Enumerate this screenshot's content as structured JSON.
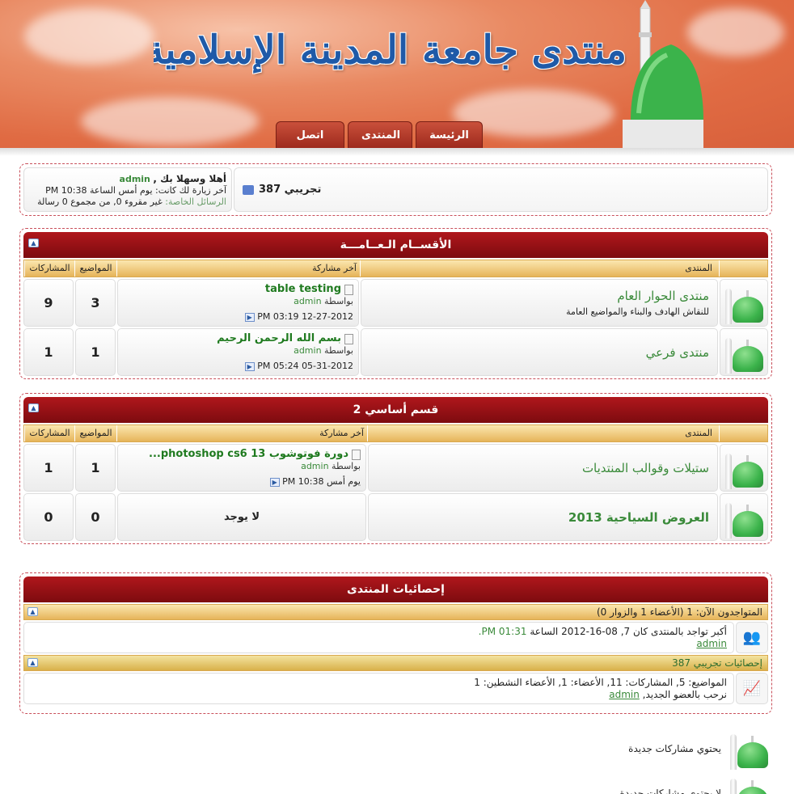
{
  "header": {
    "site_title": "منتدى جامعة المدينة الإسلامية العالمية",
    "nav": [
      {
        "label": "اتصل بنا"
      },
      {
        "label": "المنتدى"
      },
      {
        "label": "الرئيسة"
      }
    ]
  },
  "welcome": {
    "greeting": "أهلا وسهلا بك ,",
    "username": "admin",
    "last_visit": "آخر زيارة لك كانت: يوم أمس الساعة 10:38 PM",
    "pm_label": "الرسائل الخاصة:",
    "pm_value": " غير مقروء 0, من مجموع 0 رسالة",
    "site_name": "تجريبي 387"
  },
  "columns": {
    "posts": "المشاركات",
    "topics": "المواضيع",
    "last_post": "آخر مشاركة",
    "forum": "المنتدى"
  },
  "categories": [
    {
      "title": "الأقســام الـعــامـــة",
      "forums": [
        {
          "name": "منتدى الحوار العام",
          "description": "للنقاش الهادف والبناء والمواضيع العامة",
          "topics": "3",
          "posts": "9",
          "last_title": "table testing",
          "by_label": "بواسطة",
          "last_user": "admin",
          "last_date": "12-27-2012 03:19 PM"
        },
        {
          "name": "منتدى فرعي",
          "description": "",
          "topics": "1",
          "posts": "1",
          "last_title": "بسم الله الرحمن الرحيم",
          "by_label": "بواسطة",
          "last_user": "admin",
          "last_date": "05-31-2012 05:24 PM"
        }
      ]
    },
    {
      "title": "قسم أساسي 2",
      "forums": [
        {
          "name": "ستيلات وقوالب المنتديات",
          "description": "",
          "topics": "1",
          "posts": "1",
          "last_title": "دورة فوتوشوب photoshop cs6 13...",
          "by_label": "بواسطة",
          "last_user": "admin",
          "last_date": "يوم أمس 10:38 PM"
        },
        {
          "name": "العروض السياحية 2013",
          "description": "",
          "topics": "0",
          "posts": "0",
          "last_none": "لا يوجد"
        }
      ]
    }
  ],
  "stats": {
    "title": "إحصائيات المنتدى",
    "online_header": "المتواجدون الآن: 1 (الأعضاء 1 والزوار 0)",
    "max_online_text": "أكبر تواجد بالمنتدى كان 7, 08-16-2012 الساعة",
    "max_online_time": "01:31 PM.",
    "max_online_user": "admin",
    "site_stats_header": "إحصائيات تجريبي 387",
    "site_stats_text": "المواضيع: 5, المشاركات: 11, الأعضاء: 1, الأعضاء النشطين: 1",
    "welcome_new": "نرحب بالعضو الجديد,",
    "new_member": "admin"
  },
  "legend": [
    {
      "label": "يحتوي مشاركات جديدة"
    },
    {
      "label": "لا يحتوي مشاركات جديدة"
    }
  ],
  "colors": {
    "category_header": "#9e0f14",
    "column_header": "#e6b45a",
    "link_green": "#3a8a3a",
    "header_orange": "#e06b43"
  }
}
